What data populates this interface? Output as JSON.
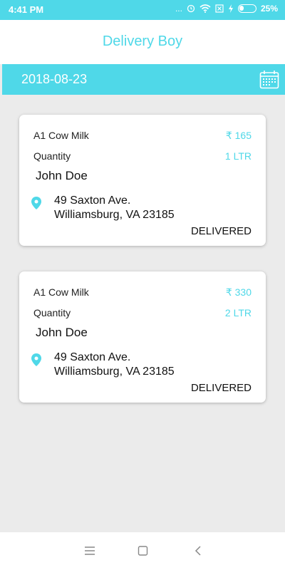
{
  "status_bar": {
    "time": "4:41 PM",
    "dots": "...",
    "battery": "25%"
  },
  "header": {
    "title": "Delivery Boy"
  },
  "date_bar": {
    "date": "2018-08-23",
    "calendar_icon": "calendar-icon"
  },
  "orders": [
    {
      "product": "A1 Cow Milk",
      "price": "₹ 165",
      "quantity_label": "Quantity",
      "quantity": "1 LTR",
      "customer": "John Doe",
      "address_line1": "49 Saxton Ave.",
      "address_line2": "Williamsburg, VA 23185",
      "status": "DELIVERED"
    },
    {
      "product": "A1 Cow Milk",
      "price": "₹ 330",
      "quantity_label": "Quantity",
      "quantity": "2 LTR",
      "customer": "John Doe",
      "address_line1": "49 Saxton Ave.",
      "address_line2": "Williamsburg, VA 23185",
      "status": "DELIVERED"
    }
  ],
  "colors": {
    "accent": "#4fd8e8",
    "background": "#ebebeb"
  }
}
